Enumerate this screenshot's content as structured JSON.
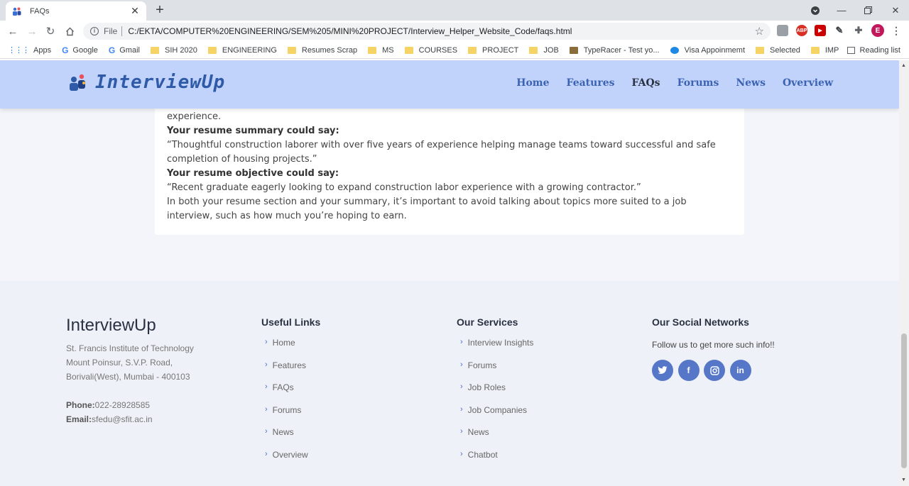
{
  "browser": {
    "tab_title": "FAQs",
    "scheme": "File",
    "url": "C:/EKTA/COMPUTER%20ENGINEERING/SEM%205/MINI%20PROJECT/Interview_Helper_Website_Code/faqs.html",
    "profile_initial": "E",
    "abp_label": "ABP",
    "bookmarks": [
      "Apps",
      "Google",
      "Gmail",
      "SIH 2020",
      "ENGINEERING",
      "Resumes Scrap",
      "MS",
      "COURSES",
      "PROJECT",
      "JOB",
      "TypeRacer - Test yo...",
      "Visa Appoinmemt",
      "Selected",
      "IMP"
    ],
    "reading_list": "Reading list"
  },
  "site": {
    "logo_text": "InterviewUp",
    "nav": [
      "Home",
      "Features",
      "FAQs",
      "Forums",
      "News",
      "Overview"
    ],
    "active_nav": "FAQs"
  },
  "faq_card": {
    "line1": "experience.",
    "summary_heading": "Your resume summary could say:",
    "summary_text": "“Thoughtful construction laborer with over five years of experience helping manage teams toward successful and safe completion of housing projects.”",
    "objective_heading": "Your resume objective could say:",
    "objective_text": "“Recent graduate eagerly looking to expand construction labor experience with a growing contractor.”",
    "closing_text": "In both your resume section and your summary, it’s important to avoid talking about topics more suited to a job interview, such as how much you’re hoping to earn."
  },
  "footer": {
    "brand": "InterviewUp",
    "address": [
      "St. Francis Institute of Technology",
      "Mount Poinsur, S.V.P. Road,",
      "Borivali(West), Mumbai - 400103"
    ],
    "phone_label": "Phone:",
    "phone": "022-28928585",
    "email_label": "Email:",
    "email": "sfedu@sfit.ac.in",
    "useful_links_title": "Useful Links",
    "useful_links": [
      "Home",
      "Features",
      "FAQs",
      "Forums",
      "News",
      "Overview"
    ],
    "services_title": "Our Services",
    "services": [
      "Interview Insights",
      "Forums",
      "Job Roles",
      "Job Companies",
      "News",
      "Chatbot"
    ],
    "social_title": "Our Social Networks",
    "social_text": "Follow us to get more such info!!",
    "social_icons": [
      "twitter-icon",
      "facebook-icon",
      "instagram-icon",
      "linkedin-icon"
    ]
  },
  "colors": {
    "header_bg": "#c1d3fb",
    "nav_link": "#3c63b2",
    "social_bg": "#5677c8"
  }
}
